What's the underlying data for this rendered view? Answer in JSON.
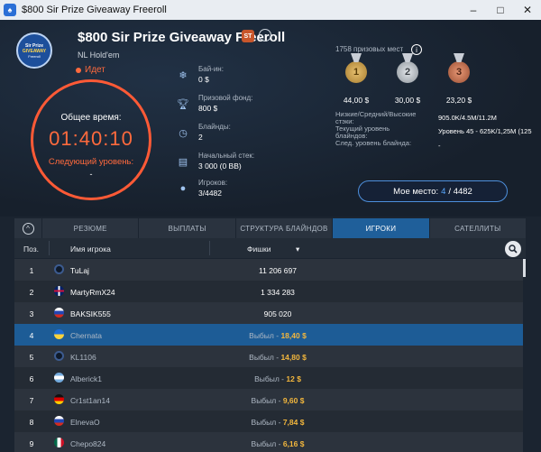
{
  "window": {
    "title": "$800 Sir Prize Giveaway Freeroll",
    "minimize": "–",
    "maximize": "□",
    "close": "✕"
  },
  "header": {
    "logo": {
      "line1": "Sir Prize",
      "line2": "GIVEAWAY",
      "line3": "Freeroll"
    },
    "tournament_name": "$800 Sir Prize Giveaway Freeroll",
    "badge": "ST",
    "more": "···",
    "game_type": "NL Hold'em",
    "status": "Идет"
  },
  "clock": {
    "label": "Общее время:",
    "time": "01:40:10",
    "next_label": "Следующий уровень:",
    "next_value": "-"
  },
  "info": [
    {
      "icon": "snowflake-icon",
      "label": "Бай-ин:",
      "value": "0 $"
    },
    {
      "icon": "trophy-icon",
      "label": "Призовой фонд:",
      "value": "800 $"
    },
    {
      "icon": "clock-icon",
      "label": "Блайнды:",
      "value": "2"
    },
    {
      "icon": "stack-icon",
      "label": "Начальный стек:",
      "value": "3 000 (0 BB)"
    },
    {
      "icon": "user-icon",
      "label": "Игроков:",
      "value": "3/4482"
    }
  ],
  "prizes": {
    "title": "1758 призовых мест",
    "medals": [
      {
        "rank": "1",
        "amount": "44,00 $"
      },
      {
        "rank": "2",
        "amount": "30,00 $"
      },
      {
        "rank": "3",
        "amount": "23,20 $"
      }
    ]
  },
  "stats": {
    "stacks_label": "Низкие/Средний/Высокие стэки:",
    "stacks_value": "905.0K/4.5M/11.2M",
    "level_label": "Текущий уровень блайндов:",
    "level_value": "Уровень 45 - 625K/1,25M (125",
    "next_level_label": "След. уровень блайнда:",
    "next_level_value": "-"
  },
  "my_place": {
    "label": "Мое место:",
    "current": "4",
    "total": "/ 4482"
  },
  "tabs": [
    "РЕЗЮМЕ",
    "ВЫПЛАТЫ",
    "СТРУКТУРА БЛАЙНДОВ",
    "ИГРОКИ",
    "САТЕЛЛИТЫ"
  ],
  "toggle": "^",
  "columns": {
    "pos": "Поз.",
    "name": "Имя игрока",
    "chips": "Фишки",
    "sort": "▾"
  },
  "players": [
    {
      "pos": "1",
      "name": "TuLaj",
      "chips": "11 206 697",
      "out_label": "",
      "prize": ""
    },
    {
      "pos": "2",
      "name": "MartyRmX24",
      "chips": "1 334 283",
      "out_label": "",
      "prize": ""
    },
    {
      "pos": "3",
      "name": "BAKSIK555",
      "chips": "905 020",
      "out_label": "",
      "prize": ""
    },
    {
      "pos": "4",
      "name": "Chernata",
      "chips": "",
      "out_label": "Выбыл -",
      "prize": "18,40 $"
    },
    {
      "pos": "5",
      "name": "KL1106",
      "chips": "",
      "out_label": "Выбыл -",
      "prize": "14,80 $"
    },
    {
      "pos": "6",
      "name": "Alberick1",
      "chips": "",
      "out_label": "Выбыл -",
      "prize": "12 $"
    },
    {
      "pos": "7",
      "name": "Cr1st1an14",
      "chips": "",
      "out_label": "Выбыл -",
      "prize": "9,60 $"
    },
    {
      "pos": "8",
      "name": "ElnevaO",
      "chips": "",
      "out_label": "Выбыл -",
      "prize": "7,84 $"
    },
    {
      "pos": "9",
      "name": "Chepo824",
      "chips": "",
      "out_label": "Выбыл -",
      "prize": "6,16 $"
    }
  ]
}
